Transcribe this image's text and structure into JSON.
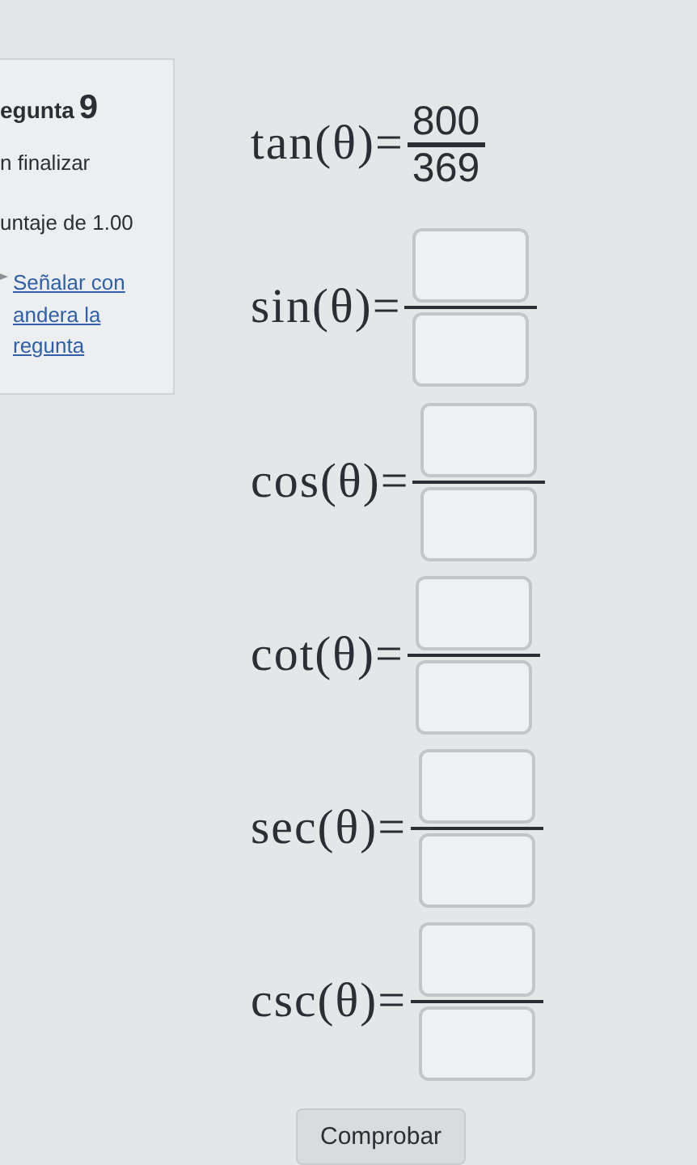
{
  "question_info": {
    "title": "egunta",
    "number": "9",
    "status": "n finalizar",
    "score": "untaje de 1.00",
    "flag_link": [
      "Señalar con",
      "andera la",
      "regunta"
    ]
  },
  "equations": [
    {
      "kind": "given",
      "label": "tan(θ)=",
      "numerator": "800",
      "denominator": "369"
    },
    {
      "kind": "input",
      "label": "sin(θ)="
    },
    {
      "kind": "input",
      "label": "cos(θ)="
    },
    {
      "kind": "input",
      "label": "cot(θ)="
    },
    {
      "kind": "input",
      "label": "sec(θ)="
    },
    {
      "kind": "input",
      "label": "csc(θ)="
    }
  ],
  "button": "Comprobar"
}
